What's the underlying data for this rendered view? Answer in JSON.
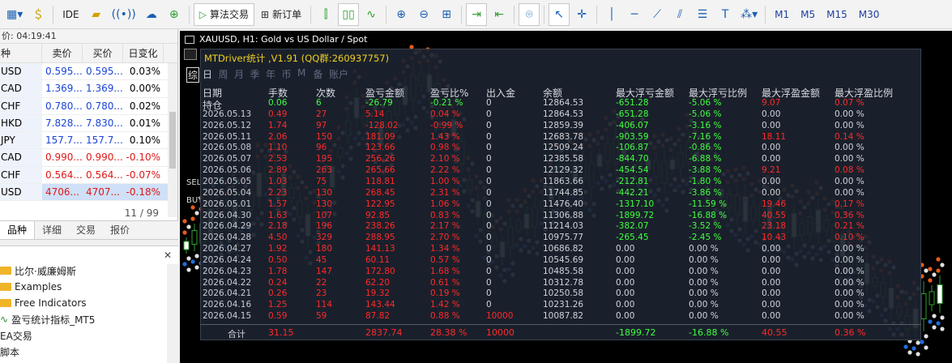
{
  "toolbar": {
    "ide": "IDE",
    "algo_trading": "算法交易",
    "new_order": "新订单",
    "timeframes": [
      "M1",
      "M5",
      "M15",
      "M30"
    ]
  },
  "market_watch": {
    "time": "价: 04:19:41",
    "headers": [
      "种",
      "卖价",
      "买价",
      "日变化"
    ],
    "rows": [
      {
        "symbol": "USD",
        "bid": "0.595...",
        "ask": "0.595...",
        "change": "0.03%",
        "dir": "up"
      },
      {
        "symbol": "CAD",
        "bid": "1.369...",
        "ask": "1.369...",
        "change": "0.00%",
        "dir": "flat"
      },
      {
        "symbol": "CHF",
        "bid": "0.780...",
        "ask": "0.780...",
        "change": "0.02%",
        "dir": "up"
      },
      {
        "symbol": "HKD",
        "bid": "7.828...",
        "ask": "7.830...",
        "change": "0.01%",
        "dir": "up"
      },
      {
        "symbol": "JPY",
        "bid": "157.7...",
        "ask": "157.7...",
        "change": "0.10%",
        "dir": "up"
      },
      {
        "symbol": "CAD",
        "bid": "0.990...",
        "ask": "0.990...",
        "change": "-0.10%",
        "dir": "down"
      },
      {
        "symbol": "CHF",
        "bid": "0.564...",
        "ask": "0.564...",
        "change": "-0.07%",
        "dir": "down"
      },
      {
        "symbol": "USD",
        "bid": "4706...",
        "ask": "4707...",
        "change": "-0.18%",
        "dir": "down"
      }
    ],
    "count": "11 / 99"
  },
  "mw_tabs": [
    "品种",
    "详细",
    "交易",
    "报价"
  ],
  "navigator": {
    "items": [
      "比尔·威廉姆斯",
      "Examples",
      "Free Indicators",
      "盈亏统计指标_MT5",
      "EA交易",
      "脚本"
    ]
  },
  "chart": {
    "title": "XAUUSD, H1:  Gold vs US Dollar / Spot",
    "buy_label": "BUY",
    "sell_label": "SELL"
  },
  "panel": {
    "title": "MTDriver统计 ,V1.91 (QQ群:260937757)",
    "tabs": [
      "综",
      "日",
      "周",
      "月",
      "季",
      "年",
      "币",
      "M",
      "备",
      "账户"
    ],
    "headers": [
      "日期",
      "手数",
      "次数",
      "盈亏金额",
      "盈亏比%",
      "出入金",
      "余额",
      "最大浮亏金额",
      "最大浮亏比例",
      "最大浮盈金额",
      "最大浮盈比例"
    ],
    "rows": [
      [
        "持仓",
        "0.06",
        "6",
        "-26.79",
        "-0.21 %",
        "0",
        "12864.53",
        "-651.28",
        "-5.06 %",
        "9.07",
        "0.07 %"
      ],
      [
        "2026.05.13",
        "0.49",
        "27",
        "5.14",
        "0.04 %",
        "0",
        "12864.53",
        "-651.28",
        "-5.06 %",
        "0.00",
        "0.00 %"
      ],
      [
        "2026.05.12",
        "1.74",
        "97",
        "-128.02",
        "-0.99 %",
        "0",
        "12859.39",
        "-406.07",
        "-3.16 %",
        "0.00",
        "0.00 %"
      ],
      [
        "2026.05.11",
        "2.06",
        "150",
        "181.09",
        "1.43 %",
        "0",
        "12683.78",
        "-903.59",
        "-7.16 %",
        "18.11",
        "0.14 %"
      ],
      [
        "2026.05.08",
        "1.10",
        "96",
        "123.66",
        "0.98 %",
        "0",
        "12509.24",
        "-106.87",
        "-0.86 %",
        "0.00",
        "0.00 %"
      ],
      [
        "2026.05.07",
        "2.53",
        "195",
        "256.26",
        "2.10 %",
        "0",
        "12385.58",
        "-844.70",
        "-6.88 %",
        "0.00",
        "0.00 %"
      ],
      [
        "2026.05.06",
        "2.89",
        "263",
        "265.66",
        "2.22 %",
        "0",
        "12129.32",
        "-454.54",
        "-3.88 %",
        "9.21",
        "0.08 %"
      ],
      [
        "2026.05.05",
        "1.03",
        "75",
        "118.81",
        "1.00 %",
        "0",
        "11863.66",
        "-212.81",
        "-1.80 %",
        "0.00",
        "0.00 %"
      ],
      [
        "2026.05.04",
        "2.23",
        "130",
        "268.45",
        "2.31 %",
        "0",
        "11744.85",
        "-442.21",
        "-3.86 %",
        "0.00",
        "0.00 %"
      ],
      [
        "2026.05.01",
        "1.57",
        "130",
        "122.95",
        "1.06 %",
        "0",
        "11476.40",
        "-1317.10",
        "-11.59 %",
        "19.46",
        "0.17 %"
      ],
      [
        "2026.04.30",
        "1.63",
        "107",
        "92.85",
        "0.83 %",
        "0",
        "11306.88",
        "-1899.72",
        "-16.88 %",
        "40.55",
        "0.36 %"
      ],
      [
        "2026.04.29",
        "2.18",
        "196",
        "238.26",
        "2.17 %",
        "0",
        "11214.03",
        "-382.07",
        "-3.52 %",
        "23.18",
        "0.21 %"
      ],
      [
        "2026.04.28",
        "4.50",
        "329",
        "288.95",
        "2.70 %",
        "0",
        "10975.77",
        "-265.45",
        "-2.45 %",
        "10.43",
        "0.10 %"
      ],
      [
        "2026.04.27",
        "1.92",
        "180",
        "141.13",
        "1.34 %",
        "0",
        "10686.82",
        "0.00",
        "0.00 %",
        "0.00",
        "0.00 %"
      ],
      [
        "2026.04.24",
        "0.50",
        "45",
        "60.11",
        "0.57 %",
        "0",
        "10545.69",
        "0.00",
        "0.00 %",
        "0.00",
        "0.00 %"
      ],
      [
        "2026.04.23",
        "1.78",
        "147",
        "172.80",
        "1.68 %",
        "0",
        "10485.58",
        "0.00",
        "0.00 %",
        "0.00",
        "0.00 %"
      ],
      [
        "2026.04.22",
        "0.24",
        "22",
        "62.20",
        "0.61 %",
        "0",
        "10312.78",
        "0.00",
        "0.00 %",
        "0.00",
        "0.00 %"
      ],
      [
        "2026.04.21",
        "0.26",
        "23",
        "19.32",
        "0.19 %",
        "0",
        "10250.58",
        "0.00",
        "0.00 %",
        "0.00",
        "0.00 %"
      ],
      [
        "2026.04.16",
        "1.25",
        "114",
        "143.44",
        "1.42 %",
        "0",
        "10231.26",
        "0.00",
        "0.00 %",
        "0.00",
        "0.00 %"
      ],
      [
        "2026.04.15",
        "0.59",
        "59",
        "87.82",
        "0.88 %",
        "10000",
        "10087.82",
        "0.00",
        "0.00 %",
        "0.00",
        "0.00 %"
      ]
    ],
    "totals": {
      "label": "合计",
      "lots": "31.15",
      "trades": "2837.74",
      "pnl_pct": "28.38 %",
      "deposit": "10000",
      "max_dd": "-1899.72",
      "max_dd_pct": "-16.88 %",
      "max_fp": "40.55",
      "max_fp_pct": "0.36 %"
    }
  },
  "colors": {
    "negative": "#ff2a2a",
    "positive_float": "#40ff40",
    "panel_title": "#f0d020"
  }
}
